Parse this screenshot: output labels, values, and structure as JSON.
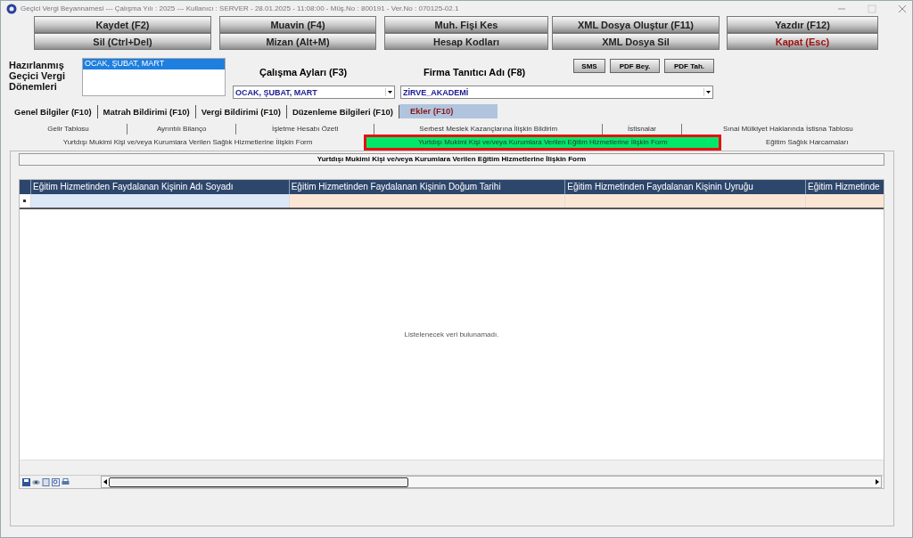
{
  "window": {
    "title": "Geçici Vergi Beyannamesi  ---  Çalışma Yılı : 2025  ---  Kullanıcı : SERVER - 28.01.2025 - 11:08:00 - Müş.No : 800191 - Ver.No : 070125-02.1"
  },
  "toolbar": [
    [
      {
        "label": "Kaydet (F2)",
        "kind": "normal"
      },
      {
        "label": "Muavin (F4)",
        "kind": "normal"
      },
      {
        "label": "Muh. Fişi Kes",
        "kind": "normal"
      },
      {
        "label": "XML Dosya Oluştur (F11)",
        "kind": "normal"
      },
      {
        "label": "Yazdır (F12)",
        "kind": "normal"
      }
    ],
    [
      {
        "label": "Sil (Ctrl+Del)",
        "kind": "normal"
      },
      {
        "label": "Mizan (Alt+M)",
        "kind": "normal"
      },
      {
        "label": "Hesap Kodları",
        "kind": "normal"
      },
      {
        "label": "XML Dosya Sil",
        "kind": "normal"
      },
      {
        "label": "Kapat (Esc)",
        "kind": "danger"
      }
    ]
  ],
  "periods": {
    "label": "Hazırlanmış Geçici Vergi Dönemleri",
    "items": [
      {
        "label": "OCAK, ŞUBAT, MART",
        "selected": true
      }
    ]
  },
  "months": {
    "label": "Çalışma Ayları (F3)",
    "value": "OCAK, ŞUBAT, MART"
  },
  "firm": {
    "label": "Firma Tanıtıcı Adı (F8)",
    "value": "ZİRVE_AKADEMİ"
  },
  "small_buttons": [
    "SMS",
    "PDF Bey.",
    "PDF Tah."
  ],
  "main_tabs": [
    {
      "label": "Genel Bilgiler (F10)",
      "selected": false
    },
    {
      "label": "Matrah Bildirimi (F10)",
      "selected": false
    },
    {
      "label": "Vergi Bildirimi (F10)",
      "selected": false
    },
    {
      "label": "Düzenleme Bilgileri  (F10)",
      "selected": false
    },
    {
      "label": "Ekler (F10)",
      "selected": true
    }
  ],
  "sub_tabs_row1": [
    {
      "label": "Gelir Tablosu",
      "selected": false
    },
    {
      "label": "Ayrıntılı Bilanço",
      "selected": false
    },
    {
      "label": "İşletme Hesabı Özeti",
      "selected": false
    },
    {
      "label": "Serbest Meslek Kazançlarına İlişkin Bildirim",
      "selected": false
    },
    {
      "label": "İstisnalar",
      "selected": false
    },
    {
      "label": "Sınai Mülkiyet Haklarında İstisna Tablosu",
      "selected": false
    }
  ],
  "sub_tabs_row2": [
    {
      "label": "Yurtdışı Mukimi Kişi ve/veya Kurumlara Verilen Sağlık Hizmetlerine İlişkin Form",
      "selected": false
    },
    {
      "label": "Yurtdışı Mukimi Kişi ve/veya Kurumlara Verilen Eğitim Hizmetlerine İlişkin Form",
      "selected": true
    },
    {
      "label": "Eğitim Sağlık Harcamaları",
      "selected": false
    }
  ],
  "form_title": "Yurtdışı Mukimi Kişi ve/veya Kurumlara Verilen Eğitim Hizmetlerine İlişkin Form",
  "grid": {
    "columns": [
      "Eğitim Hizmetinden Faydalanan Kişinin Adı Soyadı",
      "Eğitim Hizmetinden Faydalanan Kişinin Doğum Tarihi",
      "Eğitim Hizmetinden Faydalanan Kişinin Uyruğu",
      "Eğitim Hizmetinde"
    ],
    "empty_message": "Listelenecek veri bulunamadı."
  }
}
